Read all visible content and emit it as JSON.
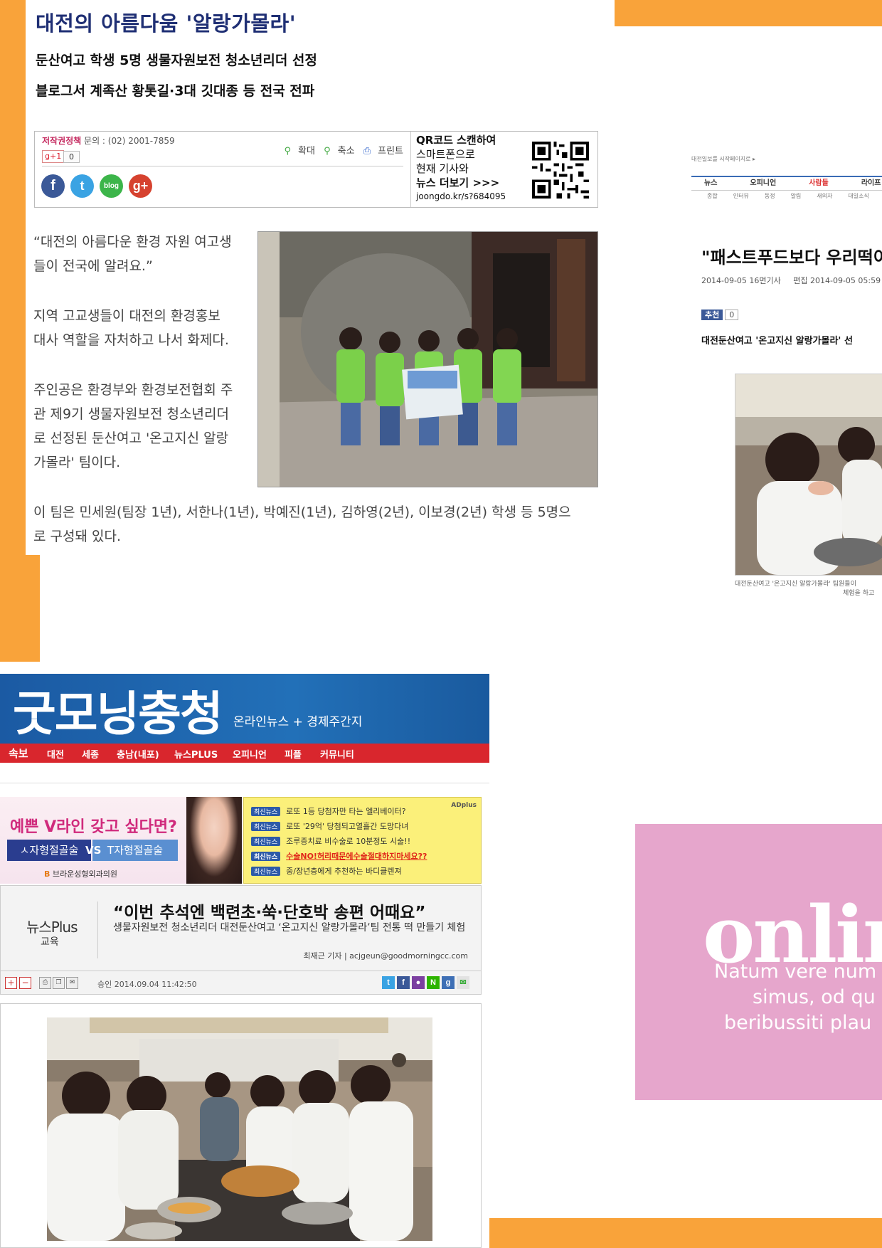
{
  "article1": {
    "title": "대전의 아름다움 '알랑가몰라'",
    "subtitle1": "둔산여고 학생 5명 생물자원보전 청소년리더 선정",
    "subtitle2": "블로그서 계족산 황톳길·3대 깃대종 등 전국 전파",
    "toolbox": {
      "copyright_label": "저작권정책",
      "contact": "문의 : (02) 2001-7859",
      "gplus_label": "g+1",
      "gplus_count": "0",
      "zoom_in": "확대",
      "zoom_out": "축소",
      "print": "프린트",
      "qr_line1": "QR코드 스캔하여",
      "qr_line2": "스마트폰으로",
      "qr_line3": "현재 기사와",
      "qr_line4": "뉴스 더보기 >>>",
      "qr_url": "joongdo.kr/s?684095",
      "social_icons": [
        "facebook-icon",
        "twitter-icon",
        "blog-icon",
        "google-plus-icon"
      ]
    },
    "para1_l1": "“대전의 아름다운 환경 자원 여고생",
    "para1_l2": "들이 전국에 알려요.”",
    "para2_l1": "지역 고교생들이 대전의 환경홍보",
    "para2_l2": "대사 역할을 자처하고 나서 화제다.",
    "para3_l1": "주인공은 환경부와 환경보전협회 주",
    "para3_l2": "관 제9기 생물자원보전 청소년리더",
    "para3_l3": "로 선정된 둔산여고 '온고지신 알랑",
    "para3_l4": "가몰라' 팀이다.",
    "para4_l1": "이 팀은 민세원(팀장 1년), 서한나(1년), 박예진(1년), 김하영(2년), 이보경(2년) 학생 등 5명으",
    "para4_l2": "로 구성돼 있다."
  },
  "right_clip": {
    "top_small": "대전일보를 시작페이지로 ▸",
    "nav": [
      "뉴스",
      "오피니언",
      "사람들",
      "라이프"
    ],
    "subnav": [
      "종합",
      "인터뷰",
      "동정",
      "알림",
      "새의자",
      "대일소식"
    ],
    "title": "\"패스트푸드보다 우리떡이",
    "date": "2014-09-05 16면기사",
    "edit": "편집 2014-09-05 05:59",
    "like_label": "추천",
    "like_count": "0",
    "lead": "대전둔산여고 '온고지신 알랑가몰라' 선",
    "caption1": "대전둔산여고 '온고지신 알랑가몰라' 팀원들이",
    "caption2": "체험을 하고"
  },
  "goodmorning": {
    "logo": "굿모닝충청",
    "tagline": "온라인뉴스 + 경제주간지",
    "nav": [
      "속보",
      "대전",
      "세종",
      "충남(내포)",
      "뉴스PLUS",
      "오피니언",
      "피플",
      "커뮤니티"
    ],
    "ad_headline": "예쁜 V라인 갖고 싶다면?",
    "ad_s": "ㅅ자형절골술",
    "ad_vs": "VS",
    "ad_t": "T자형절골술",
    "ad_clinic": "브라운성형외과의원",
    "adplus": "ADplus",
    "ad_tag": "최신뉴스",
    "ad_items": [
      "로또 1등 당첨자만 타는 엘리베이터?",
      "로또 '29억' 당첨되고열흘간 도망다녀",
      "조루증치료 비수술로 10분정도 시술!!",
      "수술NO!허리때문에수술절대하지마세요??",
      "중/장년층에게 추천하는 바디클렌져"
    ],
    "section_logo": "뉴스Plus",
    "section_cat": "교육",
    "headline": "“이번 추석엔 백련초·쑥·단호박 송편 어때요”",
    "sub": "생물자원보전 청소년리더 대전둔산여고 ‘온고지신 알랑가몰라’팀 전통 떡 만들기 체험",
    "byline": "최재근 기자 | acjgeun@goodmorningcc.com",
    "approved": "승인 2014.09.04  11:42:50"
  },
  "pink": {
    "big": "onlin",
    "line1": "Natum vere num",
    "line2": "simus, od qu",
    "line3": "beribussiti plau"
  },
  "colors": {
    "orange": "#f9a33a",
    "pink": "#e6a6cc",
    "title_navy": "#1f2f74",
    "gm_blue": "#1b5aa3",
    "gm_red": "#d9262d"
  }
}
